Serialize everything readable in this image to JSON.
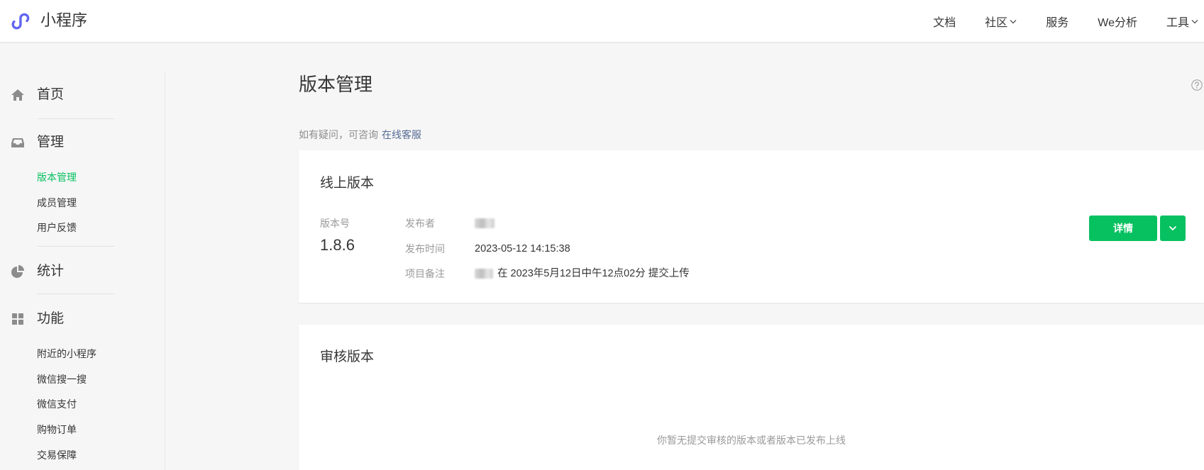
{
  "app": {
    "logo_icon": "mini-program-logo-icon",
    "logo_text": "小程序"
  },
  "header": {
    "nav": [
      {
        "label": "文档"
      },
      {
        "label": "社区",
        "icon": "chevron-down-icon"
      },
      {
        "label": "服务"
      },
      {
        "label": "We分析"
      },
      {
        "label": "工具",
        "icon": "chevron-down-icon"
      }
    ]
  },
  "sidebar": {
    "sections": [
      {
        "label": "首页",
        "icon": "home-icon"
      },
      {
        "label": "管理",
        "icon": "inbox-icon",
        "items": [
          {
            "label": "版本管理",
            "active": true
          },
          {
            "label": "成员管理"
          },
          {
            "label": "用户反馈"
          }
        ]
      },
      {
        "label": "统计",
        "icon": "pie-chart-icon"
      },
      {
        "label": "功能",
        "icon": "grid-icon",
        "items": [
          {
            "label": "附近的小程序"
          },
          {
            "label": "微信搜一搜"
          },
          {
            "label": "微信支付"
          },
          {
            "label": "购物订单"
          },
          {
            "label": "交易保障"
          }
        ]
      }
    ]
  },
  "page": {
    "title": "版本管理",
    "help_icon": "help-icon",
    "consult_text": "如有疑问，可咨询",
    "consult_link": "在线客服"
  },
  "online_version": {
    "title": "线上版本",
    "version_label": "版本号",
    "version": "1.8.6",
    "publisher_label": "发布者",
    "publish_time_label": "发布时间",
    "publish_time": "2023-05-12 14:15:38",
    "remark_label": "项目备注",
    "remark_text": "在 2023年5月12日中午12点02分 提交上传",
    "detail_button": "详情",
    "more_icon": "chevron-down-icon"
  },
  "review_version": {
    "title": "审核版本",
    "empty_text": "你暂无提交审核的版本或者版本已发布上线"
  },
  "colors": {
    "accent": "#07c160",
    "link": "#576b95",
    "text": "#353535",
    "muted": "#9a9a9a",
    "logo": "#6265f0",
    "background": "#f6f6f6"
  }
}
